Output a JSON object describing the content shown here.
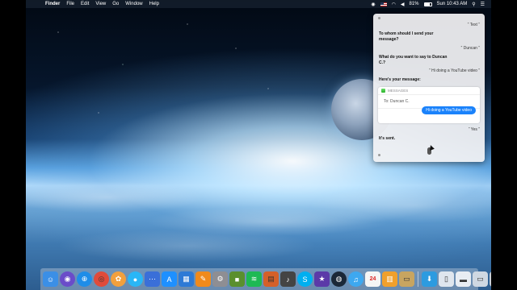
{
  "menubar": {
    "app_name": "Finder",
    "items": [
      "File",
      "Edit",
      "View",
      "Go",
      "Window",
      "Help"
    ],
    "battery": "81%",
    "clock": "Sun 10:43 AM"
  },
  "siri": {
    "conversation": [
      {
        "role": "user",
        "text": "“ Text ”"
      },
      {
        "role": "siri",
        "text": "To whom should I send your message?"
      },
      {
        "role": "user",
        "text": "“ Duncan ”"
      },
      {
        "role": "siri",
        "text": "What do you want to say to Duncan C.?"
      },
      {
        "role": "user",
        "text": "“ Hi doing a YouTube video ”"
      },
      {
        "role": "siri",
        "text": "Here's your message:"
      }
    ],
    "card": {
      "app_label": "MESSAGES",
      "to": "To: Duncan C.",
      "message": "Hi doing a YouTube video"
    },
    "after": [
      {
        "role": "user",
        "text": "“ Yes ”"
      },
      {
        "role": "siri",
        "text": "It's sent."
      }
    ]
  },
  "dock": {
    "apps": [
      {
        "name": "finder-icon",
        "color": "#3b8fe6",
        "glyph": "☺"
      },
      {
        "name": "siri-icon",
        "color": "#6a4cc9",
        "glyph": "◉"
      },
      {
        "name": "safari-icon",
        "color": "#1f8de8",
        "glyph": "⊕"
      },
      {
        "name": "chrome-icon",
        "color": "#e04b3b",
        "glyph": "◎"
      },
      {
        "name": "photos-icon",
        "color": "#f2a03d",
        "glyph": "✿"
      },
      {
        "name": "messages-icon",
        "color": "#29b6f6",
        "glyph": "●"
      },
      {
        "name": "dots-app-icon",
        "color": "#3a6fd8",
        "glyph": "⋯"
      },
      {
        "name": "app-store-icon",
        "color": "#1e90ff",
        "glyph": "A"
      },
      {
        "name": "keynote-icon",
        "color": "#2d7ad6",
        "glyph": "▦"
      },
      {
        "name": "pages-icon",
        "color": "#f08a1c",
        "glyph": "✎"
      },
      {
        "name": "system-preferences-icon",
        "color": "#8e8e93",
        "glyph": "⚙"
      },
      {
        "name": "minecraft-icon",
        "color": "#5a8f2e",
        "glyph": "■"
      },
      {
        "name": "spotify-icon",
        "color": "#1db954",
        "glyph": "≋"
      },
      {
        "name": "ibooks-icon",
        "color": "#d4602a",
        "glyph": "▤"
      },
      {
        "name": "garageband-icon",
        "color": "#444444",
        "glyph": "♪"
      },
      {
        "name": "skype-icon",
        "color": "#00aff0",
        "glyph": "S"
      },
      {
        "name": "imovie-icon",
        "color": "#5b3aa8",
        "glyph": "★"
      },
      {
        "name": "steam-icon",
        "color": "#1b2838",
        "glyph": "◍"
      },
      {
        "name": "itunes-icon",
        "color": "#3da8f0",
        "glyph": "♫"
      },
      {
        "name": "calendar-icon",
        "color": "#f5f5f5",
        "glyph": "24"
      },
      {
        "name": "books-icon",
        "color": "#f0a02c",
        "glyph": "▥"
      },
      {
        "name": "notes-icon",
        "color": "#c8a560",
        "glyph": "▭"
      }
    ],
    "docs": [
      {
        "name": "downloads-stack-icon",
        "color": "#2c9be0",
        "glyph": "⬇"
      },
      {
        "name": "document-icon",
        "color": "#dfe6ee",
        "glyph": "▯"
      },
      {
        "name": "folder-icon",
        "color": "#e8edf3",
        "glyph": "▬"
      },
      {
        "name": "screenshot-icon",
        "color": "#cfd8e2",
        "glyph": "▭"
      },
      {
        "name": "trash-icon",
        "color": "#c9ced6",
        "glyph": "🗑"
      }
    ]
  }
}
